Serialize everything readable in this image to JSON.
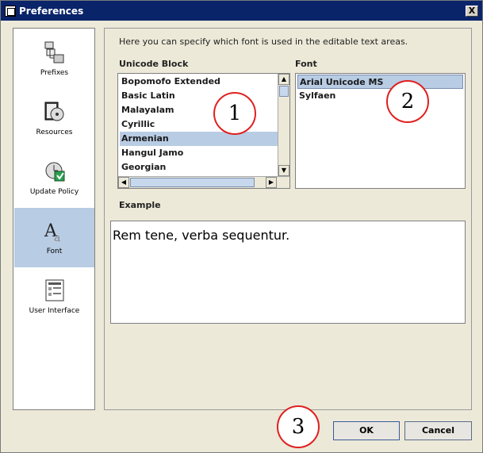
{
  "window": {
    "title": "Preferences",
    "close_glyph": "X"
  },
  "sidebar": {
    "items": [
      {
        "label": "Prefixes",
        "icon": "prefixes-icon",
        "selected": false
      },
      {
        "label": "Resources",
        "icon": "resources-icon",
        "selected": false
      },
      {
        "label": "Update Policy",
        "icon": "update-policy-icon",
        "selected": false
      },
      {
        "label": "Font",
        "icon": "font-icon",
        "selected": true
      },
      {
        "label": "User Interface",
        "icon": "user-interface-icon",
        "selected": false
      }
    ]
  },
  "main": {
    "intro": "Here you can specify which font is used in the editable text areas.",
    "unicode_block": {
      "label": "Unicode Block",
      "items": [
        "Bopomofo Extended",
        "Basic Latin",
        "Malayalam",
        "Cyrillic",
        "Armenian",
        "Hangul Jamo",
        "Georgian"
      ],
      "selected": "Armenian"
    },
    "font": {
      "label": "Font",
      "items": [
        "Arial Unicode MS",
        "Sylfaen"
      ],
      "selected": "Arial Unicode MS"
    },
    "example": {
      "label": "Example",
      "text": "Rem tene, verba sequentur."
    }
  },
  "buttons": {
    "ok": "OK",
    "cancel": "Cancel"
  },
  "callouts": [
    "1",
    "2",
    "3"
  ],
  "colors": {
    "titlebar": "#0a246a",
    "selection": "#b8cce4",
    "callout_border": "#e02020"
  }
}
